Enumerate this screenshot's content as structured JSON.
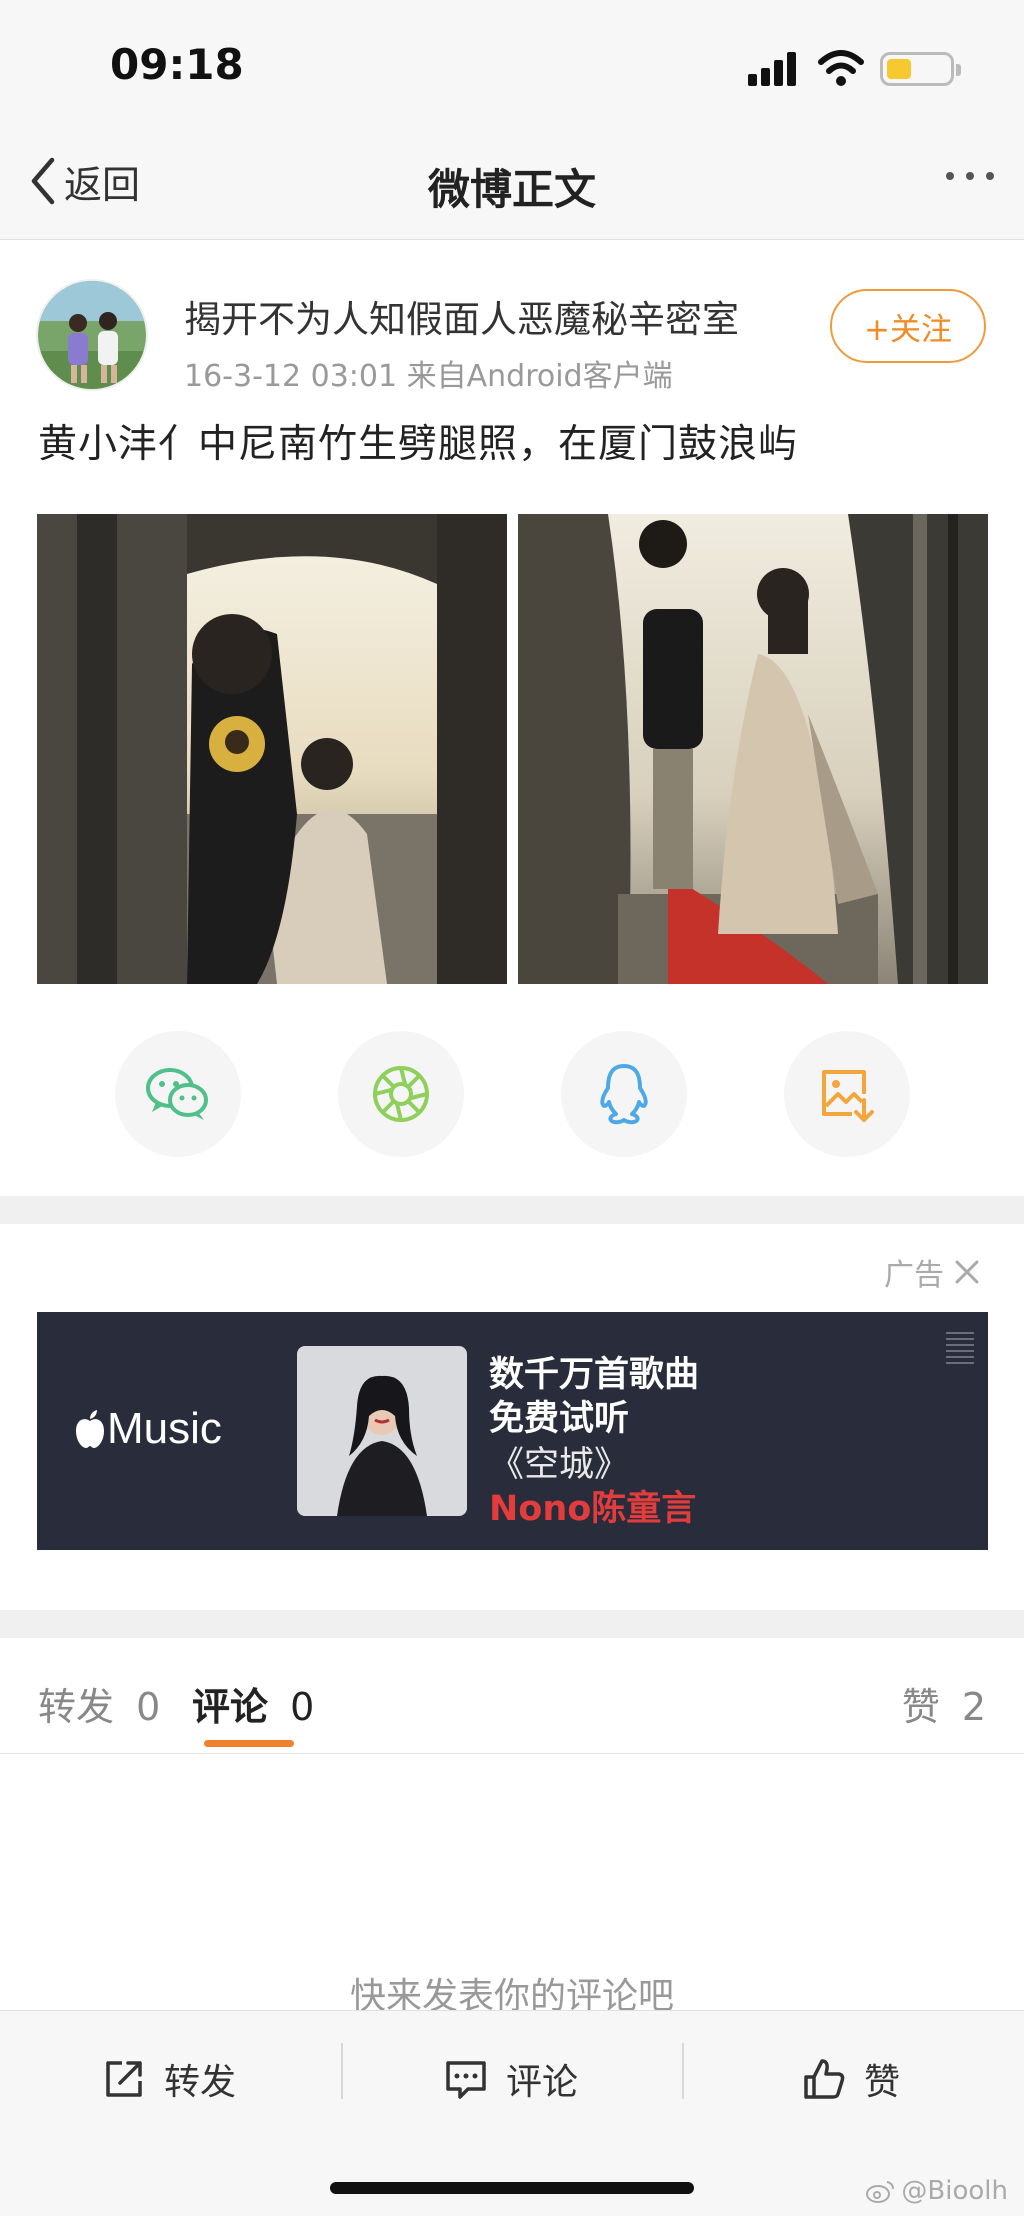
{
  "status_bar": {
    "time": "09:18",
    "signal_icon": "signal-icon",
    "wifi_icon": "wifi-icon",
    "battery_icon": "battery-icon",
    "battery_color": "#f5c92f"
  },
  "nav": {
    "back_label": "返回",
    "title": "微博正文",
    "back_icon": "chevron-left-icon",
    "more_icon": "more-icon"
  },
  "post": {
    "author": "揭开不为人知假面人恶魔秘辛密室",
    "meta": "16-3-12 03:01  来自Android客户端",
    "follow_label": "+关注",
    "text": "黄小沣亻中尼南竹生劈腿照，在厦门鼓浪屿",
    "share_buttons": [
      "wechat-icon",
      "moments-icon",
      "qq-icon",
      "save-image-icon"
    ]
  },
  "ad": {
    "label": "广告",
    "brand": "Music",
    "line1": "数千万首歌曲",
    "line2": "免费试听",
    "line3": "《空城》",
    "line4": "Nono陈童言"
  },
  "tabs": {
    "repost": "转发",
    "repost_count": "0",
    "comment": "评论",
    "comment_count": "0",
    "like": "赞",
    "like_count": "2"
  },
  "comments": {
    "empty_hint": "快来发表你的评论吧"
  },
  "toolbar": {
    "repost": "转发",
    "comment": "评论",
    "like": "赞"
  },
  "watermark": "@Bioolh",
  "colors": {
    "accent": "#f08b25",
    "tab_underline": "#f0822e",
    "ad_bg": "#292c3a",
    "ad_artist": "#e23c3c"
  }
}
